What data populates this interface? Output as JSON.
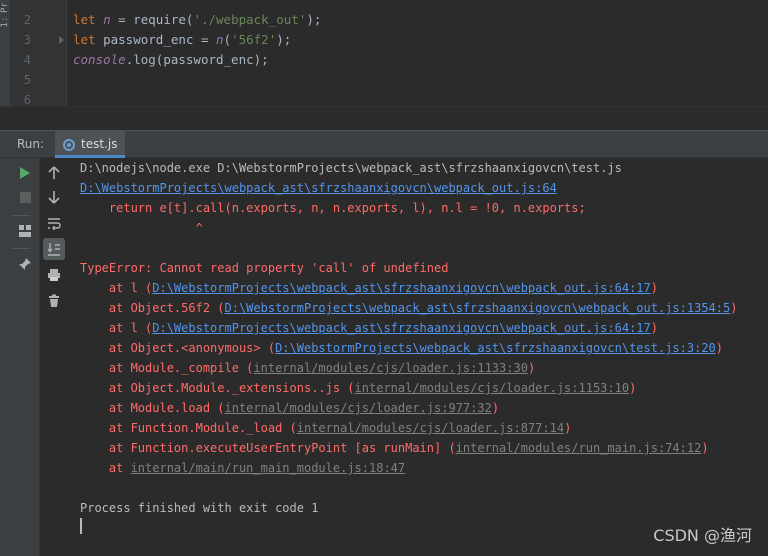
{
  "sidebar_strip": {
    "label": "1: Pr"
  },
  "editor": {
    "lines": [
      {
        "num": "2",
        "tokens": [
          {
            "t": "let ",
            "c": "kw"
          },
          {
            "t": "n",
            "c": "v-n"
          },
          {
            "t": " = ",
            "c": "call"
          },
          {
            "t": "require(",
            "c": "call"
          },
          {
            "t": "'./webpack_out'",
            "c": "str"
          },
          {
            "t": ");",
            "c": "call"
          }
        ]
      },
      {
        "num": "3",
        "tokens": [
          {
            "t": "let ",
            "c": "kw"
          },
          {
            "t": "password_enc = ",
            "c": "call"
          },
          {
            "t": "n",
            "c": "v-n"
          },
          {
            "t": "(",
            "c": "call"
          },
          {
            "t": "'56f2'",
            "c": "str"
          },
          {
            "t": ");",
            "c": "call"
          }
        ]
      },
      {
        "num": "4",
        "tokens": [
          {
            "t": "console",
            "c": "global"
          },
          {
            "t": ".log(password_enc);",
            "c": "call"
          }
        ]
      },
      {
        "num": "5",
        "tokens": []
      },
      {
        "num": "6",
        "tokens": []
      }
    ]
  },
  "run_panel": {
    "label": "Run:",
    "tab_label": "test.js"
  },
  "console": {
    "lines": [
      {
        "segs": [
          {
            "t": "D:\\nodejs\\node.exe D:\\WebstormProjects\\webpack_ast\\sfrzshaanxigovcn\\test.js",
            "c": "c-plain"
          }
        ]
      },
      {
        "segs": [
          {
            "t": "D:\\WebstormProjects\\webpack_ast\\sfrzshaanxigovcn\\webpack_out.js:64",
            "c": "c-link"
          }
        ]
      },
      {
        "segs": [
          {
            "t": "    return e[t].call(n.exports, n, n.exports, l), n.l = !0, n.exports;",
            "c": "c-err"
          }
        ]
      },
      {
        "segs": [
          {
            "t": "                ^",
            "c": "c-err"
          }
        ]
      },
      {
        "segs": []
      },
      {
        "segs": [
          {
            "t": "TypeError: Cannot read property 'call' of undefined",
            "c": "c-err"
          }
        ]
      },
      {
        "segs": [
          {
            "t": "    at l (",
            "c": "c-err"
          },
          {
            "t": "D:\\WebstormProjects\\webpack_ast\\sfrzshaanxigovcn\\webpack_out.js:64:17",
            "c": "c-errlink"
          },
          {
            "t": ")",
            "c": "c-err"
          }
        ]
      },
      {
        "segs": [
          {
            "t": "    at Object.56f2 (",
            "c": "c-err"
          },
          {
            "t": "D:\\WebstormProjects\\webpack_ast\\sfrzshaanxigovcn\\webpack_out.js:1354:5",
            "c": "c-errlink"
          },
          {
            "t": ")",
            "c": "c-err"
          }
        ]
      },
      {
        "segs": [
          {
            "t": "    at l (",
            "c": "c-err"
          },
          {
            "t": "D:\\WebstormProjects\\webpack_ast\\sfrzshaanxigovcn\\webpack_out.js:64:17",
            "c": "c-errlink"
          },
          {
            "t": ")",
            "c": "c-err"
          }
        ]
      },
      {
        "segs": [
          {
            "t": "    at Object.<anonymous> (",
            "c": "c-err"
          },
          {
            "t": "D:\\WebstormProjects\\webpack_ast\\sfrzshaanxigovcn\\test.js:3:20",
            "c": "c-errlink"
          },
          {
            "t": ")",
            "c": "c-err"
          }
        ]
      },
      {
        "segs": [
          {
            "t": "    at Module._compile (",
            "c": "c-err"
          },
          {
            "t": "internal/modules/cjs/loader.js:1133:30",
            "c": "c-grey"
          },
          {
            "t": ")",
            "c": "c-err"
          }
        ]
      },
      {
        "segs": [
          {
            "t": "    at Object.Module._extensions..js (",
            "c": "c-err"
          },
          {
            "t": "internal/modules/cjs/loader.js:1153:10",
            "c": "c-grey"
          },
          {
            "t": ")",
            "c": "c-err"
          }
        ]
      },
      {
        "segs": [
          {
            "t": "    at Module.load (",
            "c": "c-err"
          },
          {
            "t": "internal/modules/cjs/loader.js:977:32",
            "c": "c-grey"
          },
          {
            "t": ")",
            "c": "c-err"
          }
        ]
      },
      {
        "segs": [
          {
            "t": "    at Function.Module._load (",
            "c": "c-err"
          },
          {
            "t": "internal/modules/cjs/loader.js:877:14",
            "c": "c-grey"
          },
          {
            "t": ")",
            "c": "c-err"
          }
        ]
      },
      {
        "segs": [
          {
            "t": "    at Function.executeUserEntryPoint [as runMain] (",
            "c": "c-err"
          },
          {
            "t": "internal/modules/run_main.js:74:12",
            "c": "c-grey"
          },
          {
            "t": ")",
            "c": "c-err"
          }
        ]
      },
      {
        "segs": [
          {
            "t": "    at ",
            "c": "c-err"
          },
          {
            "t": "internal/main/run_main_module.js:18:47",
            "c": "c-grey"
          }
        ]
      },
      {
        "segs": []
      },
      {
        "segs": [
          {
            "t": "Process finished with exit code 1",
            "c": "c-plain"
          }
        ]
      }
    ]
  },
  "watermark": "CSDN @渔河"
}
